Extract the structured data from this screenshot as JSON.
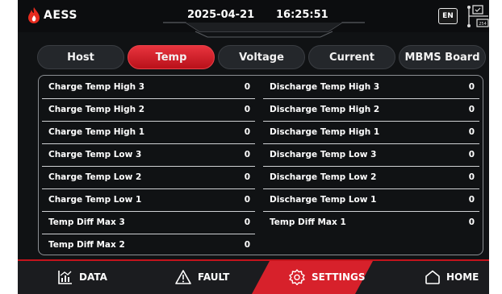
{
  "header": {
    "logo_text": "AESS",
    "date": "2025-04-21",
    "time": "16:25:51",
    "language": "EN",
    "icons": [
      "flame-logo-icon",
      "network-status-icon"
    ]
  },
  "tabs": [
    {
      "label": "Host",
      "active": false
    },
    {
      "label": "Temp",
      "active": true
    },
    {
      "label": "Voltage",
      "active": false
    },
    {
      "label": "Current",
      "active": false
    },
    {
      "label": "MBMS Board",
      "active": false
    }
  ],
  "table": {
    "left": [
      {
        "label": "Charge Temp High 3",
        "value": "0"
      },
      {
        "label": "Charge Temp High 2",
        "value": "0"
      },
      {
        "label": "Charge Temp High 1",
        "value": "0"
      },
      {
        "label": "Charge Temp Low 3",
        "value": "0"
      },
      {
        "label": "Charge Temp Low 2",
        "value": "0"
      },
      {
        "label": "Charge Temp Low 1",
        "value": "0"
      },
      {
        "label": "Temp Diff Max 3",
        "value": "0"
      },
      {
        "label": "Temp Diff Max 2",
        "value": "0"
      }
    ],
    "right": [
      {
        "label": "Discharge Temp High 3",
        "value": "0"
      },
      {
        "label": "Discharge Temp High 2",
        "value": "0"
      },
      {
        "label": "Discharge Temp High 1",
        "value": "0"
      },
      {
        "label": "Discharge Temp Low 3",
        "value": "0"
      },
      {
        "label": "Discharge Temp Low 2",
        "value": "0"
      },
      {
        "label": "Discharge Temp Low 1",
        "value": "0"
      },
      {
        "label": "Temp Diff Max 1",
        "value": "0"
      }
    ]
  },
  "nav": {
    "items": [
      {
        "label": "DATA",
        "icon": "chart-icon",
        "active": false
      },
      {
        "label": "FAULT",
        "icon": "warning-icon",
        "active": false
      },
      {
        "label": "SETTINGS",
        "icon": "gear-icon",
        "active": true
      },
      {
        "label": "HOME",
        "icon": "home-icon",
        "active": false
      }
    ]
  },
  "colors": {
    "accent": "#d7212b",
    "background": "#101214",
    "divider": "#cfd1d4"
  }
}
